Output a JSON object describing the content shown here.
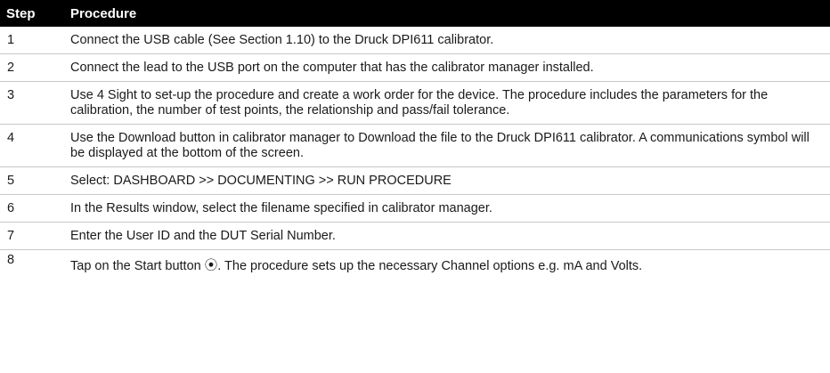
{
  "table": {
    "headers": {
      "step": "Step",
      "procedure": "Procedure"
    },
    "rows": [
      {
        "step": "1",
        "procedure": "Connect the USB cable (See Section 1.10) to the Druck DPI611 calibrator."
      },
      {
        "step": "2",
        "procedure": "Connect the lead to the USB port on the computer that has the calibrator manager installed."
      },
      {
        "step": "3",
        "procedure": "Use 4 Sight to set-up the procedure and create a work order for the device. The procedure includes the parameters for the calibration, the number of test points, the relationship and pass/fail tolerance."
      },
      {
        "step": "4",
        "procedure": "Use the Download button in calibrator manager to Download the file to the Druck DPI611 calibrator. A communications symbol will be displayed at the bottom of the screen."
      },
      {
        "step": "5",
        "procedure": "Select: DASHBOARD >> DOCUMENTING >> RUN PROCEDURE"
      },
      {
        "step": "6",
        "procedure": "In the Results window, select the filename specified in calibrator manager."
      },
      {
        "step": "7",
        "procedure": "Enter the User ID and the DUT Serial Number."
      },
      {
        "step": "8",
        "procedure": "Tap on the Start button ⦿. The procedure sets up the necessary Channel options e.g. mA and Volts."
      }
    ]
  }
}
